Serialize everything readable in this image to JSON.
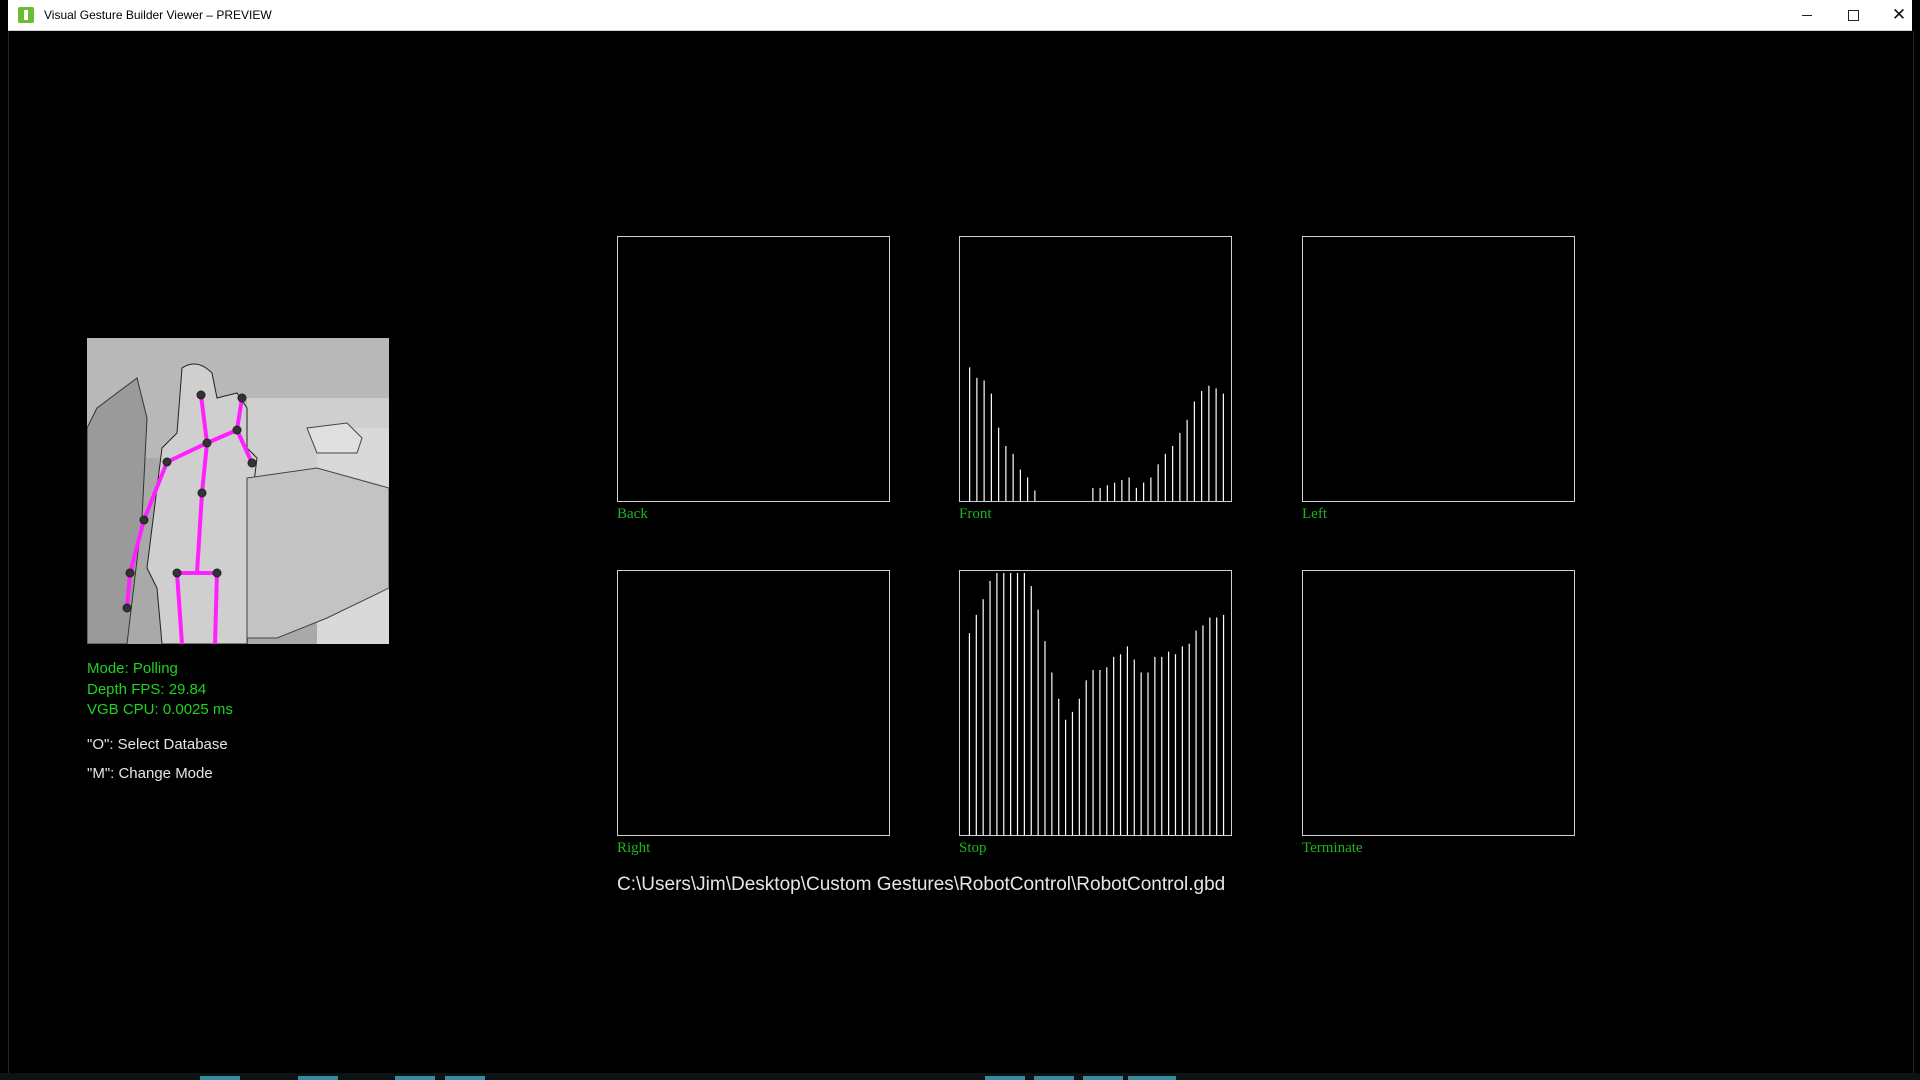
{
  "window": {
    "title": "Visual Gesture Builder Viewer – PREVIEW",
    "controls": {
      "minimize": "—",
      "maximize": "☐",
      "close": "✕"
    }
  },
  "status": {
    "mode": "Mode: Polling",
    "fps": "Depth FPS: 29.84",
    "cpu": "VGB CPU: 0.0025 ms"
  },
  "help": {
    "select_db": "\"O\":  Select Database",
    "change_mode": "\"M\":  Change Mode"
  },
  "gestures": [
    {
      "label": "Back",
      "values": []
    },
    {
      "label": "Front",
      "values": [
        0.51,
        0.47,
        0.46,
        0.41,
        0.28,
        0.21,
        0.18,
        0.12,
        0.09,
        0.04,
        0,
        0,
        0,
        0,
        0,
        0,
        0,
        0.05,
        0.05,
        0.06,
        0.07,
        0.08,
        0.09,
        0.05,
        0.07,
        0.09,
        0.14,
        0.18,
        0.21,
        0.26,
        0.31,
        0.38,
        0.42,
        0.44,
        0.43,
        0.41
      ]
    },
    {
      "label": "Left",
      "values": []
    },
    {
      "label": "Right",
      "values": []
    },
    {
      "label": "Stop",
      "values": [
        0.77,
        0.84,
        0.9,
        0.97,
        1,
        1,
        1,
        1,
        1,
        0.95,
        0.86,
        0.74,
        0.62,
        0.52,
        0.44,
        0.47,
        0.52,
        0.59,
        0.63,
        0.63,
        0.64,
        0.68,
        0.69,
        0.72,
        0.67,
        0.62,
        0.62,
        0.68,
        0.68,
        0.7,
        0.69,
        0.72,
        0.73,
        0.78,
        0.8,
        0.83,
        0.83,
        0.84
      ]
    },
    {
      "label": "Terminate",
      "values": []
    }
  ],
  "database_path": "C:\\Users\\Jim\\Desktop\\Custom Gestures\\RobotControl\\RobotControl.gbd",
  "colors": {
    "status_text": "#1fd31f",
    "gesture_label": "#1fb51f",
    "skeleton": "#ff20ff",
    "bars": "#ffffff"
  }
}
